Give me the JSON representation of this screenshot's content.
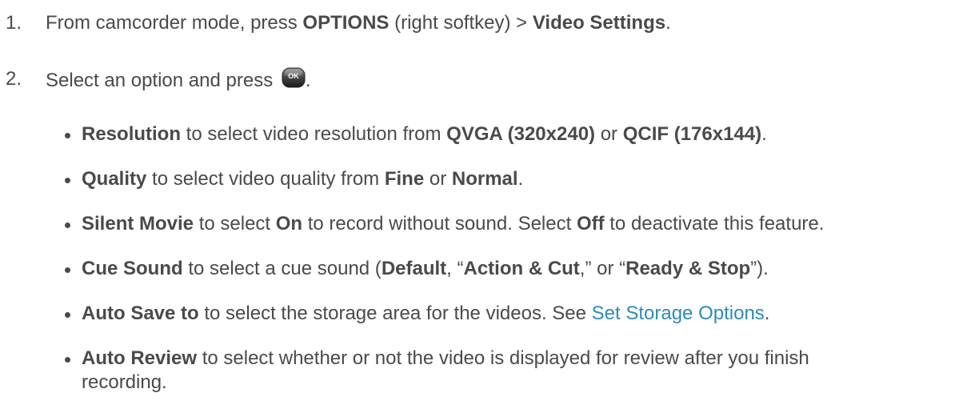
{
  "steps": [
    {
      "number": "1.",
      "pre": "From camcorder mode, press ",
      "b1": "OPTIONS",
      "mid": " (right softkey) > ",
      "b2": "Video Settings",
      "post": "."
    },
    {
      "number": "2.",
      "pre": "Select an option and press ",
      "key_label": "OK",
      "post": "."
    }
  ],
  "bullets": [
    {
      "b1": "Resolution",
      "t1": " to select video resolution from ",
      "b2": "QVGA (320x240)",
      "t2": " or ",
      "b3": "QCIF (176x144)",
      "t3": "."
    },
    {
      "b1": "Quality",
      "t1": " to select video quality from ",
      "b2": "Fine",
      "t2": " or ",
      "b3": "Normal",
      "t3": "."
    },
    {
      "b1": "Silent Movie",
      "t1": " to select ",
      "b2": "On",
      "t2": " to record without sound. Select ",
      "b3": "Off",
      "t3": " to deactivate this feature."
    },
    {
      "b1": "Cue Sound",
      "t1": " to select a cue sound (",
      "b2": "Default",
      "t2": ", “",
      "b3": "Action & Cut",
      "t3": ",” or “",
      "b4": "Ready & Stop",
      "t4": "”)."
    },
    {
      "b1": "Auto Save to",
      "t1": "  to select the storage area for the videos. See ",
      "link": "Set Storage Options",
      "t2": "."
    },
    {
      "b1": "Auto Review",
      "t1": " to select whether or not the video is displayed for review after you finish",
      "t2": "recording."
    }
  ],
  "colors": {
    "text": "#4a4a4a",
    "link": "#2e8bb3"
  },
  "icons": {
    "ok_key": "ok-key-icon"
  }
}
